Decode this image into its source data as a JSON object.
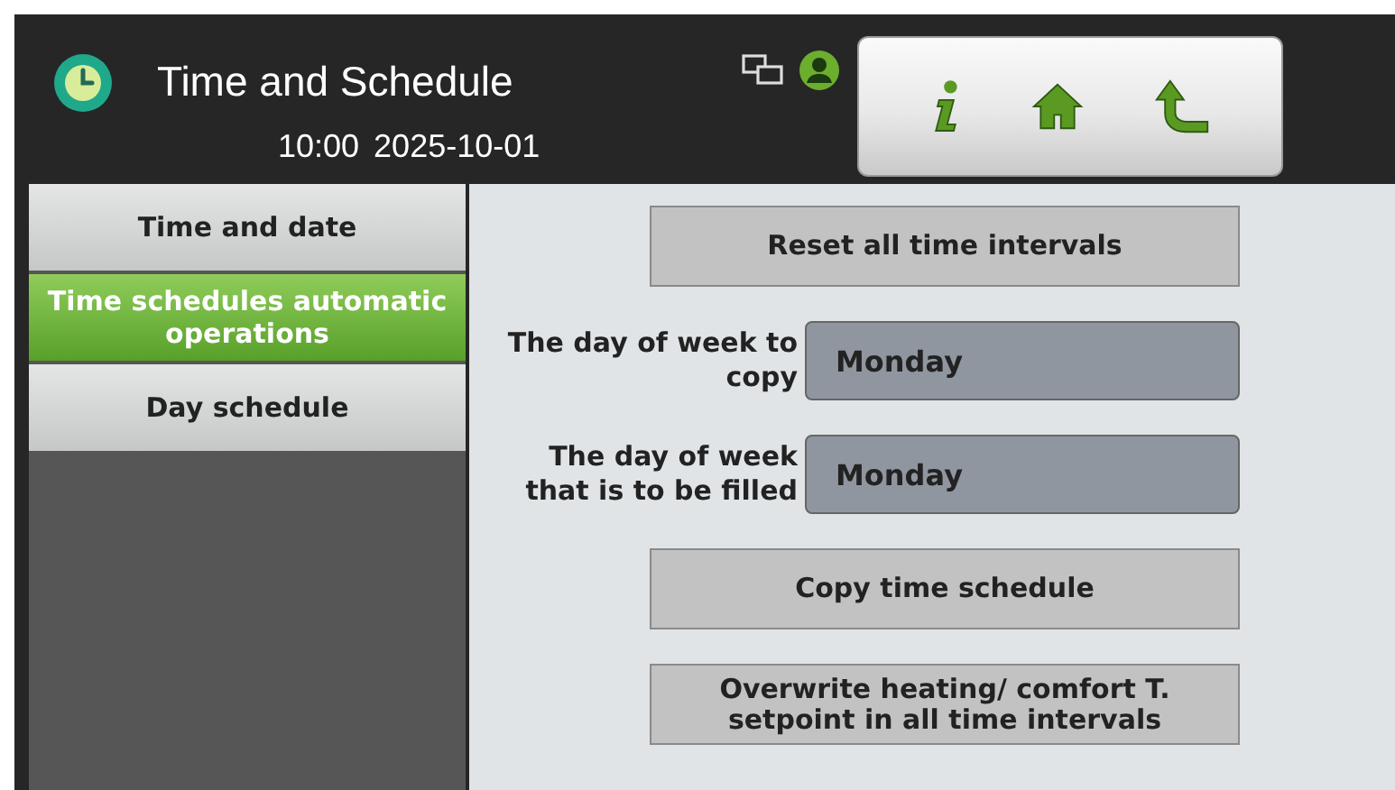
{
  "header": {
    "title": "Time and Schedule",
    "time": "10:00",
    "date": "2025-10-01"
  },
  "sidebar": {
    "items": [
      {
        "label": "Time and date",
        "selected": false
      },
      {
        "label": "Time schedules automatic operations",
        "selected": true
      },
      {
        "label": "Day schedule",
        "selected": false
      }
    ]
  },
  "content": [
    {
      "kind": "button",
      "label": "Reset all time intervals"
    },
    {
      "kind": "dropdown",
      "label": "The day of week to copy",
      "value": "Monday"
    },
    {
      "kind": "dropdown",
      "label": "The day of week that is to be filled",
      "value": "Monday"
    },
    {
      "kind": "button",
      "label": "Copy time schedule"
    },
    {
      "kind": "button",
      "label": "Overwrite heating/ comfort T. setpoint in all time intervals"
    }
  ]
}
